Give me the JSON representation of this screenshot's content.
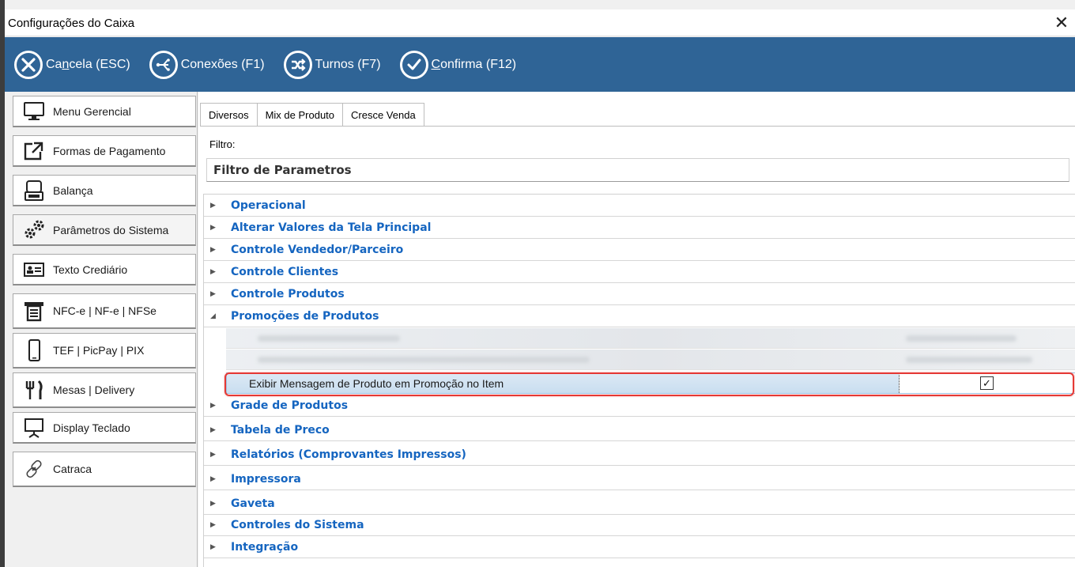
{
  "window": {
    "title": "Configurações do Caixa",
    "close_glyph": "✕"
  },
  "toolbar": {
    "cancel": {
      "pre": "Ca",
      "u": "n",
      "post": "cela (ESC)",
      "icon": "cancel-circle-icon"
    },
    "conexoes": {
      "label": "Conexões (F1)",
      "icon": "connections-icon"
    },
    "turnos": {
      "label": "Turnos (F7)",
      "icon": "shuffle-icon"
    },
    "confirma": {
      "u": "C",
      "post": "onfirma (F12)",
      "icon": "check-circle-icon"
    }
  },
  "sidebar": {
    "items": [
      {
        "label": "Menu Gerencial",
        "icon": "monitor-icon"
      },
      {
        "label": "Formas de Pagamento",
        "icon": "external-link-icon"
      },
      {
        "label": "Balança",
        "icon": "scale-icon"
      },
      {
        "label": "Parâmetros do Sistema",
        "icon": "gears-icon"
      },
      {
        "label": "Texto Crediário",
        "icon": "id-card-icon"
      },
      {
        "label": "NFC-e | NF-e | NFSe",
        "icon": "receipt-printer-icon"
      },
      {
        "label": "TEF | PicPay | PIX",
        "icon": "smartphone-icon"
      },
      {
        "label": "Mesas | Delivery",
        "icon": "fork-knife-icon"
      },
      {
        "label": "Display Teclado",
        "icon": "display-screen-icon"
      },
      {
        "label": "Catraca",
        "icon": "link-icon"
      }
    ],
    "active_index": 3
  },
  "tabs": [
    "Diversos",
    "Mix de Produto",
    "Cresce Venda"
  ],
  "active_tab": 0,
  "filter": {
    "label": "Filtro:",
    "value": "Filtro de Parametros"
  },
  "groups": [
    {
      "label": "Operacional",
      "expanded": false
    },
    {
      "label": "Alterar Valores da Tela Principal",
      "expanded": false
    },
    {
      "label": "Controle Vendedor/Parceiro",
      "expanded": false
    },
    {
      "label": "Controle Clientes",
      "expanded": false
    },
    {
      "label": "Controle Produtos",
      "expanded": false
    },
    {
      "label": "Promoções de Produtos",
      "expanded": true
    },
    {
      "label": "Grade de Produtos",
      "expanded": false
    },
    {
      "label": "Tabela de Preco",
      "expanded": false
    },
    {
      "label": "Relatórios (Comprovantes Impressos)",
      "expanded": false
    },
    {
      "label": "Impressora",
      "expanded": false
    },
    {
      "label": "Gaveta",
      "expanded": false
    },
    {
      "label": "Controles do Sistema",
      "expanded": false
    },
    {
      "label": "Integração",
      "expanded": false
    }
  ],
  "expanded_rows": {
    "selected": {
      "label": "Exibir Mensagem de Produto em Promoção no Item",
      "checked": true,
      "check_glyph": "✓"
    }
  },
  "glyphs": {
    "collapsed": "▶",
    "expanded": "◢"
  },
  "colors": {
    "toolbar": "#2f6496",
    "group_label": "#1565c0",
    "highlight": "#e53935"
  }
}
